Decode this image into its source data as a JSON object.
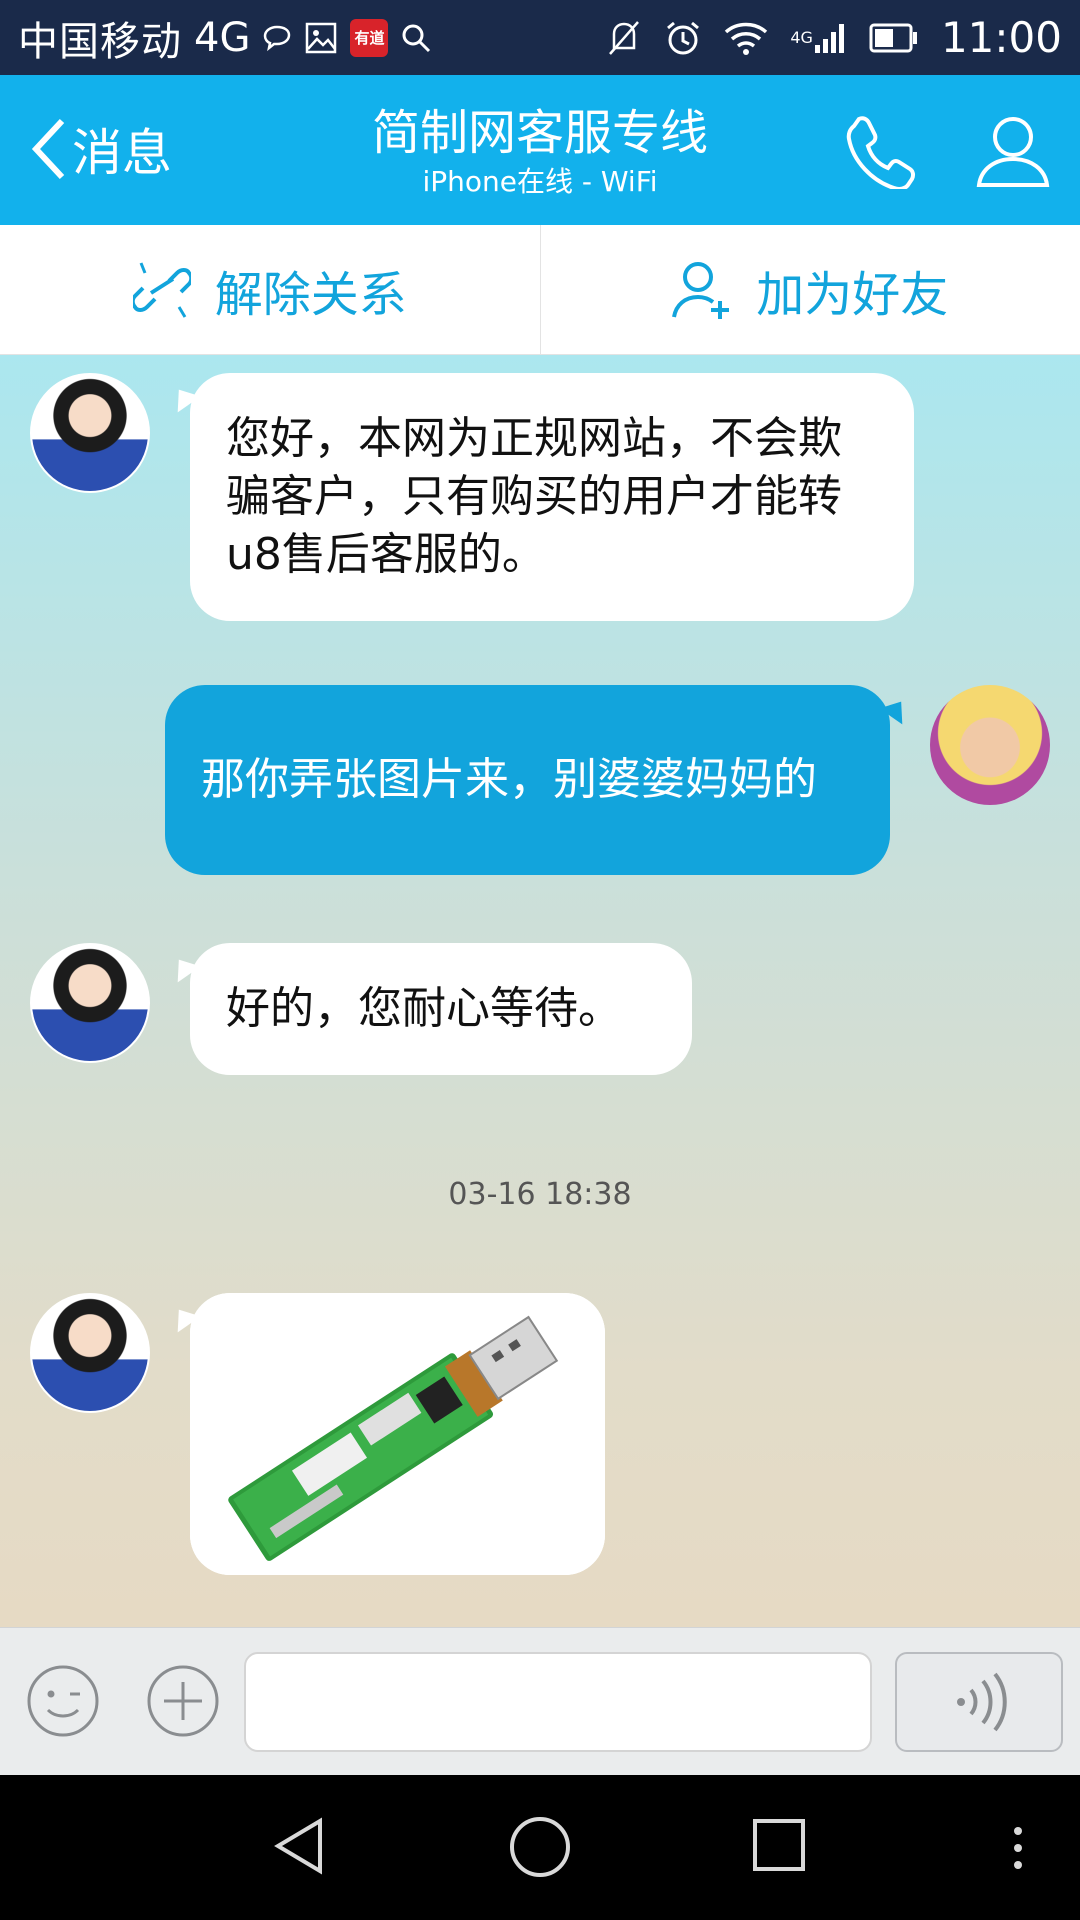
{
  "status_bar": {
    "carrier": "中国移动",
    "network": "4G",
    "youdao_label": "有道",
    "signal_label": "4G",
    "time": "11:00"
  },
  "header": {
    "back_label": "消息",
    "title": "简制网客服专线",
    "subtitle": "iPhone在线 - WiFi"
  },
  "actions": {
    "unlink_label": "解除关系",
    "add_friend_label": "加为好友"
  },
  "messages": [
    {
      "from": "contact",
      "text": "您好，本网为正规网站，不会欺骗客户，只有购买的用户才能转u8售后客服的。"
    },
    {
      "from": "me",
      "text": "那你弄张图片来，别婆婆妈妈的"
    },
    {
      "from": "contact",
      "text": "好的，您耐心等待。"
    },
    {
      "from": "contact",
      "type": "image",
      "content": "usb-wifi-adapter-photo"
    }
  ],
  "timestamp": "03-16 18:38",
  "input": {
    "value": "",
    "placeholder": ""
  },
  "colors": {
    "title_bar": "#12b1ec",
    "accent": "#12a4dc",
    "status_bar": "#1a2a4a"
  }
}
